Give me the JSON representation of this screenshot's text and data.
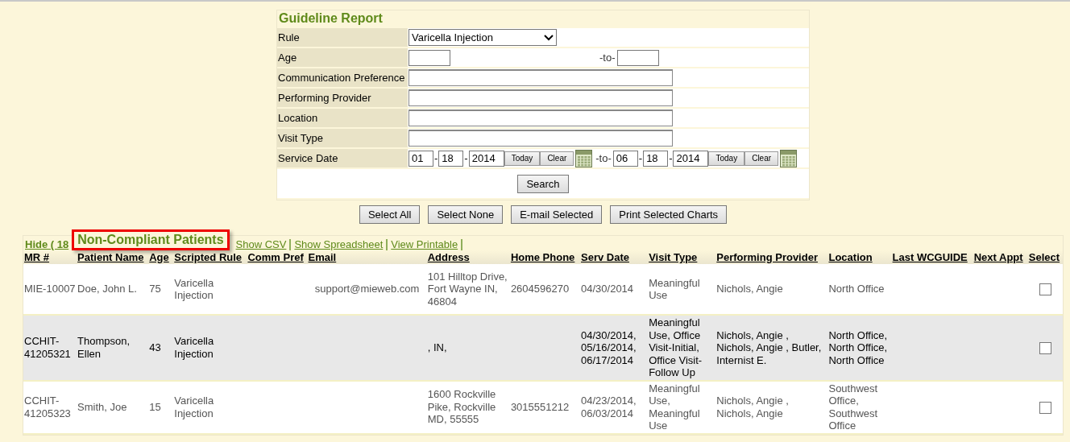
{
  "form": {
    "title": "Guideline Report",
    "rows": [
      {
        "kind": "select",
        "label": "Rule",
        "value": "Varicella Injection"
      },
      {
        "kind": "range",
        "label": "Age",
        "to_label": "-to-"
      },
      {
        "kind": "textarea",
        "label": "Communication Preference"
      },
      {
        "kind": "textarea",
        "label": "Performing Provider"
      },
      {
        "kind": "textarea",
        "label": "Location"
      },
      {
        "kind": "textarea",
        "label": "Visit Type"
      },
      {
        "kind": "daterange",
        "label": "Service Date",
        "to_label": "-to-",
        "separator": "-",
        "from": {
          "month": "01",
          "day": "18",
          "year": "2014",
          "today": "Today",
          "clear": "Clear"
        },
        "to": {
          "month": "06",
          "day": "18",
          "year": "2014",
          "today": "Today",
          "clear": "Clear"
        }
      }
    ],
    "search_button": "Search"
  },
  "actions": [
    "Select All",
    "Select None",
    "E-mail Selected",
    "Print Selected Charts"
  ],
  "results": {
    "hide_link": "Hide ( 18",
    "title": "Non-Compliant Patients",
    "links": [
      "Show CSV",
      "Show Spreadsheet",
      "View Printable"
    ],
    "table": {
      "columns": [
        "MR #",
        "Patient Name",
        "Age",
        "Scripted Rule",
        "Comm Pref",
        "Email",
        "Address",
        "Home Phone",
        "Serv Date",
        "Visit Type",
        "Performing Provider",
        "Location",
        "Last WCGUIDE",
        "Next Appt",
        "Select"
      ],
      "rows": [
        {
          "highlighted": false,
          "checked": false,
          "cells": [
            "MIE-10007",
            "Doe, John L.",
            "75",
            "Varicella Injection",
            "",
            "support@mieweb.com",
            "101 Hilltop Drive, Fort Wayne IN, 46804",
            "2604596270",
            "04/30/2014",
            "Meaningful Use",
            "Nichols, Angie",
            "North Office",
            "",
            ""
          ]
        },
        {
          "highlighted": true,
          "checked": false,
          "cells": [
            "CCHIT-41205321",
            "Thompson, Ellen",
            "43",
            "Varicella Injection",
            "",
            "",
            ", IN,",
            "",
            "04/30/2014, 05/16/2014, 06/17/2014",
            "Meaningful Use, Office Visit-Initial, Office Visit-Follow Up",
            "Nichols, Angie , Nichols, Angie , Butler, Internist E.",
            "North Office, North Office, North Office",
            "",
            ""
          ]
        },
        {
          "highlighted": false,
          "checked": false,
          "cells": [
            "CCHIT-41205323",
            "Smith, Joe",
            "15",
            "Varicella Injection",
            "",
            "",
            "1600 Rockville Pike, Rockville MD, 55555",
            "3015551212",
            "04/23/2014, 06/03/2014",
            "Meaningful Use, Meaningful Use",
            "Nichols, Angie , Nichols, Angie",
            "Southwest Office, Southwest Office",
            "",
            ""
          ]
        }
      ]
    }
  }
}
